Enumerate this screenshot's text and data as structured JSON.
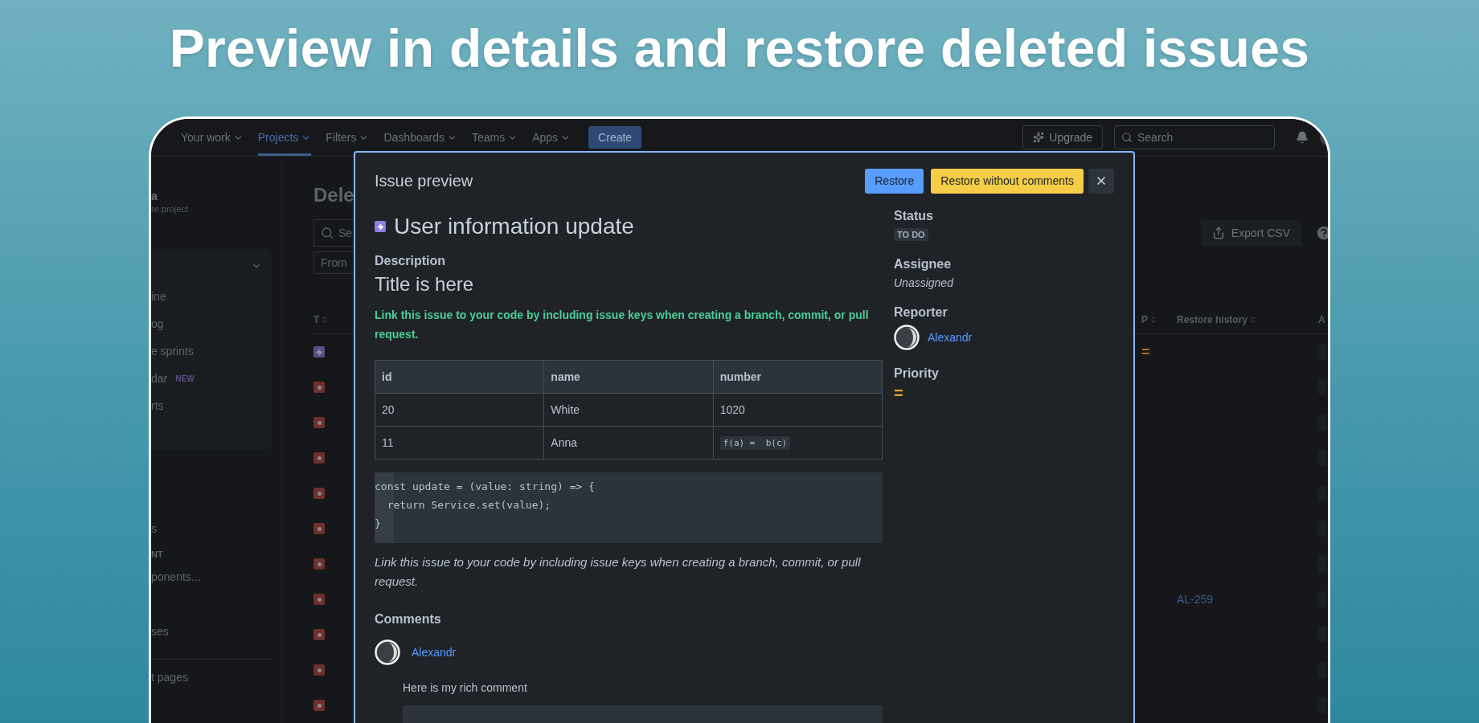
{
  "headline": "Preview in details and restore deleted issues",
  "nav": {
    "items": [
      {
        "label": "Your work",
        "selected": false
      },
      {
        "label": "Projects",
        "selected": true
      },
      {
        "label": "Filters",
        "selected": false
      },
      {
        "label": "Dashboards",
        "selected": false
      },
      {
        "label": "Teams",
        "selected": false
      },
      {
        "label": "Apps",
        "selected": false
      }
    ],
    "create": "Create",
    "upgrade": "Upgrade",
    "search_placeholder": "Search"
  },
  "sidebar": {
    "project_name": "a",
    "project_type": "re project",
    "group_items": [
      {
        "label": "ine"
      },
      {
        "label": "og"
      },
      {
        "label": "e sprints"
      },
      {
        "label": "dar",
        "badge": "NEW"
      },
      {
        "label": "rts"
      }
    ],
    "items": [
      {
        "label": "s",
        "kind": "item"
      },
      {
        "label": "NT",
        "kind": "heading"
      },
      {
        "label": "ponents...",
        "kind": "item"
      },
      {
        "label": "ses",
        "kind": "item"
      },
      {
        "label": "t pages",
        "kind": "item"
      }
    ]
  },
  "page": {
    "title": "Dele",
    "search_placeholder": "Se",
    "from_filter": "From",
    "export": "Export CSV",
    "columns": [
      {
        "label": "T"
      },
      {
        "label": "P"
      },
      {
        "label": "Restore history"
      },
      {
        "label": "A"
      }
    ],
    "rows": [
      {
        "kind": "feature",
        "priority": "="
      },
      {
        "kind": "bug"
      },
      {
        "kind": "bug"
      },
      {
        "kind": "bug"
      },
      {
        "kind": "bug"
      },
      {
        "kind": "bug"
      },
      {
        "kind": "bug"
      },
      {
        "kind": "bug",
        "restore_history": "AL-259"
      },
      {
        "kind": "bug"
      },
      {
        "kind": "bug"
      },
      {
        "kind": "bug"
      }
    ]
  },
  "modal": {
    "title": "Issue preview",
    "buttons": [
      {
        "label": "Restore",
        "kind": "primary"
      },
      {
        "label": "Restore without comments",
        "kind": "warning"
      }
    ],
    "issue": {
      "title": "User information update",
      "kind": "feature"
    },
    "description": {
      "label": "Description",
      "heading": "Title is here",
      "highlight": "Link this issue to your code by including issue keys when creating a branch, commit, or pull request.",
      "table": {
        "columns": [
          "id",
          "name",
          "number"
        ],
        "rows": [
          [
            {
              "text": "20",
              "kind": "text"
            },
            {
              "text": "White",
              "kind": "text"
            },
            {
              "text": "1020",
              "kind": "text"
            }
          ],
          [
            {
              "text": "11",
              "kind": "text"
            },
            {
              "text": "Anna",
              "kind": "text"
            },
            {
              "text": "f(a) =  b(c)",
              "kind": "code"
            }
          ]
        ]
      },
      "code": [
        "const update = (value: string) => {",
        "  return Service.set(value);",
        "}"
      ],
      "note": "Link this issue to your code by including issue keys when creating a branch, commit, or pull request."
    },
    "comments": {
      "label": "Comments",
      "items": [
        {
          "author": "Alexandr",
          "text": "Here is my rich comment"
        }
      ]
    },
    "fields": [
      {
        "label": "Status",
        "kind": "status",
        "value": "TO DO"
      },
      {
        "label": "Assignee",
        "kind": "italic",
        "value": "Unassigned"
      },
      {
        "label": "Reporter",
        "kind": "user",
        "value": "Alexandr"
      },
      {
        "label": "Priority",
        "kind": "priority",
        "value": "="
      }
    ]
  }
}
